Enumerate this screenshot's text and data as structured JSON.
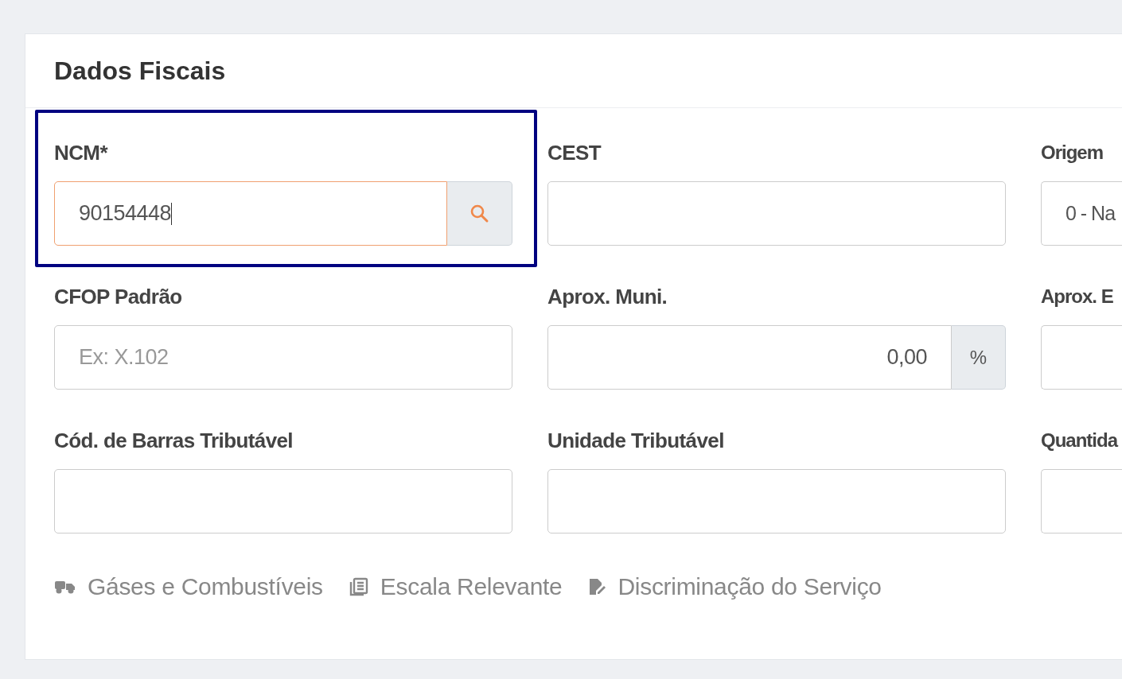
{
  "card": {
    "title": "Dados Fiscais"
  },
  "fields": [
    {
      "label": "NCM*",
      "kind": "search",
      "value": "90154448",
      "focused": true,
      "highlighted": true
    },
    {
      "label": "CEST",
      "kind": "text",
      "focused": false,
      "highlighted": false
    },
    {
      "label": "Origem",
      "kind": "text",
      "value": "0 - Na",
      "focused": false,
      "highlighted": false
    },
    {
      "label": "CFOP Padrão",
      "kind": "text",
      "placeholder": "Ex: X.102",
      "focused": false,
      "highlighted": false
    },
    {
      "label": "Aprox. Muni.",
      "kind": "percent",
      "value": "0,00",
      "addon": "%",
      "focused": false,
      "highlighted": false
    },
    {
      "label": "Aprox. E",
      "kind": "text",
      "focused": false,
      "highlighted": false
    },
    {
      "label": "Cód. de Barras Tributável",
      "kind": "text",
      "focused": false,
      "highlighted": false
    },
    {
      "label": "Unidade Tributável",
      "kind": "text",
      "focused": false,
      "highlighted": false
    },
    {
      "label": "Quantida",
      "kind": "text",
      "focused": false,
      "highlighted": false
    }
  ],
  "links": [
    {
      "label": "Gáses e Combustíveis",
      "kind": "truck"
    },
    {
      "label": "Escala Relevante",
      "kind": "pages"
    },
    {
      "label": "Discriminação do Serviço",
      "kind": "edit"
    }
  ]
}
